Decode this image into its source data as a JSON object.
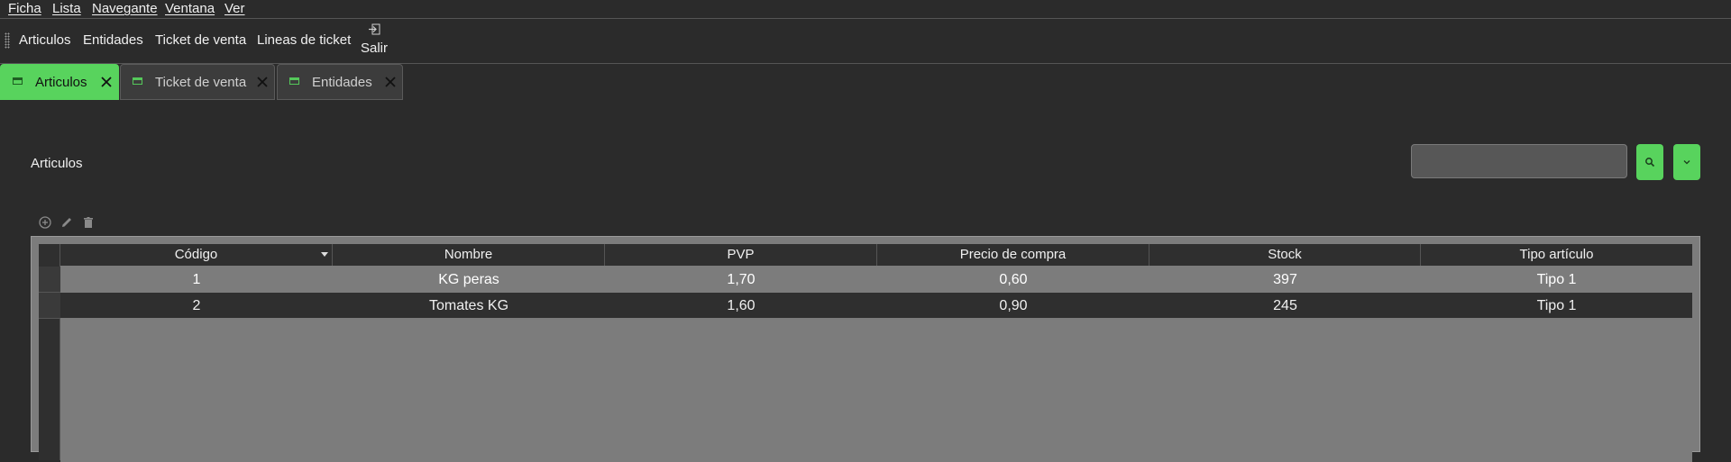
{
  "menu": [
    "Ficha",
    "Lista",
    "Navegante",
    "Ventana",
    "Ver"
  ],
  "toolbar": {
    "items": [
      "Articulos",
      "Entidades",
      "Ticket de venta",
      "Lineas de ticket"
    ],
    "exit_label": "Salir"
  },
  "tabs": [
    {
      "label": "Articulos",
      "active": true
    },
    {
      "label": "Ticket de venta",
      "active": false
    },
    {
      "label": "Entidades",
      "active": false
    }
  ],
  "page": {
    "title": "Articulos",
    "search": {
      "value": "",
      "placeholder": ""
    }
  },
  "colors": {
    "accent": "#58d35d",
    "background": "#2b2b2b",
    "grid_bg": "#7c7c7c"
  },
  "icons": [
    "add-icon",
    "edit-icon",
    "delete-icon",
    "search-icon",
    "chevron-down-icon",
    "exit-icon",
    "window-icon",
    "close-tab-icon"
  ],
  "table": {
    "columns": [
      "Código",
      "Nombre",
      "PVP",
      "Precio de compra",
      "Stock",
      "Tipo artículo"
    ],
    "sorted_column": "Código",
    "rows": [
      [
        "1",
        "KG peras",
        "1,70",
        "0,60",
        "397",
        "Tipo 1"
      ],
      [
        "2",
        "Tomates KG",
        "1,60",
        "0,90",
        "245",
        "Tipo 1"
      ]
    ]
  }
}
